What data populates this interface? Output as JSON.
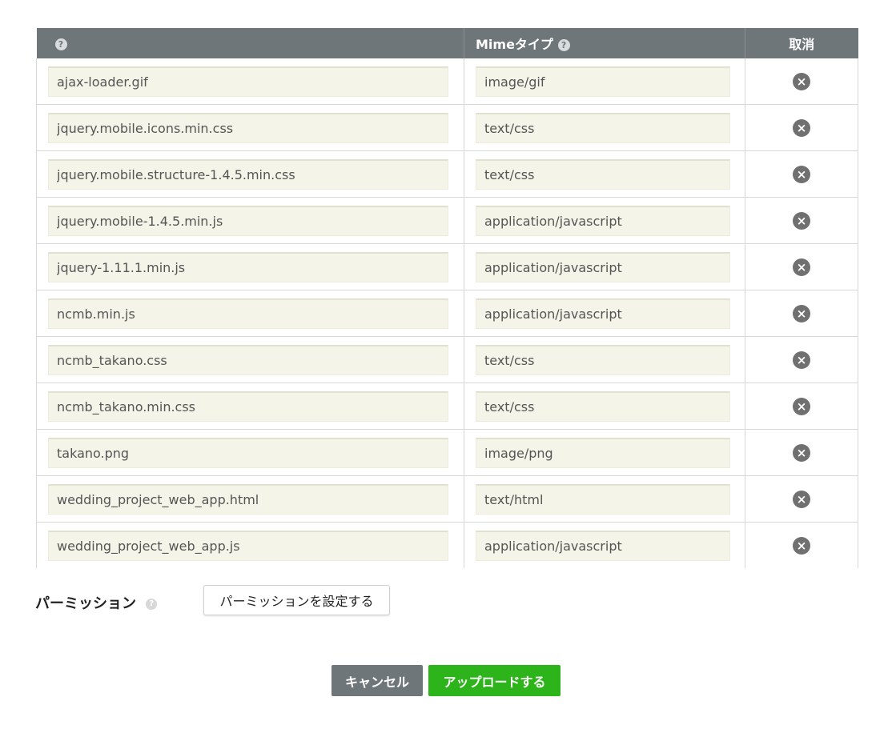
{
  "table": {
    "headers": {
      "name_help": "?",
      "mime_label": "Mimeタイプ",
      "mime_help": "?",
      "cancel_label": "取消"
    },
    "cancel_icon": "×",
    "rows": [
      {
        "name": "ajax-loader.gif",
        "mime": "image/gif"
      },
      {
        "name": "jquery.mobile.icons.min.css",
        "mime": "text/css"
      },
      {
        "name": "jquery.mobile.structure-1.4.5.min.css",
        "mime": "text/css"
      },
      {
        "name": "jquery.mobile-1.4.5.min.js",
        "mime": "application/javascript"
      },
      {
        "name": "jquery-1.11.1.min.js",
        "mime": "application/javascript"
      },
      {
        "name": "ncmb.min.js",
        "mime": "application/javascript"
      },
      {
        "name": "ncmb_takano.css",
        "mime": "text/css"
      },
      {
        "name": "ncmb_takano.min.css",
        "mime": "text/css"
      },
      {
        "name": "takano.png",
        "mime": "image/png"
      },
      {
        "name": "wedding_project_web_app.html",
        "mime": "text/html"
      },
      {
        "name": "wedding_project_web_app.js",
        "mime": "application/javascript"
      }
    ]
  },
  "permission": {
    "label": "パーミッション",
    "help": "?",
    "button": "パーミッションを設定する"
  },
  "actions": {
    "cancel": "キャンセル",
    "upload": "アップロードする"
  },
  "colors": {
    "header_bg": "#6f767a",
    "input_bg": "#f5f4e8",
    "upload_green": "#2db41a"
  }
}
